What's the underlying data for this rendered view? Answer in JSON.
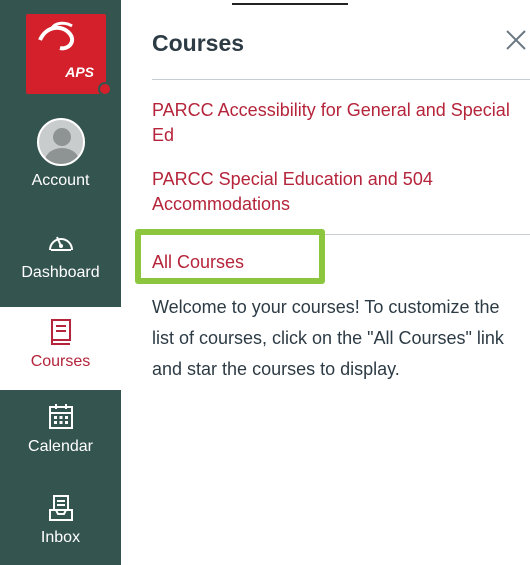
{
  "sidebar": {
    "logo_text": "APS",
    "items": [
      {
        "label": "Account",
        "icon": "user-avatar-icon"
      },
      {
        "label": "Dashboard",
        "icon": "dashboard-gauge-icon"
      },
      {
        "label": "Courses",
        "icon": "book-icon",
        "active": true
      },
      {
        "label": "Calendar",
        "icon": "calendar-icon"
      },
      {
        "label": "Inbox",
        "icon": "inbox-icon"
      }
    ]
  },
  "tray": {
    "title": "Courses",
    "close_icon": "close-icon",
    "courses": [
      {
        "name": "PARCC Accessibility for General and Special Ed"
      },
      {
        "name": "PARCC Special Education and 504 Accommodations"
      }
    ],
    "all_courses_label": "All Courses",
    "welcome_text": "Welcome to your courses! To customize the list of courses, click on the \"All Courses\" link and star the courses to display."
  },
  "colors": {
    "sidebar_bg": "#34544f",
    "link": "#b5243a",
    "highlight": "#8cc63f",
    "logo_bg": "#d3202a"
  }
}
